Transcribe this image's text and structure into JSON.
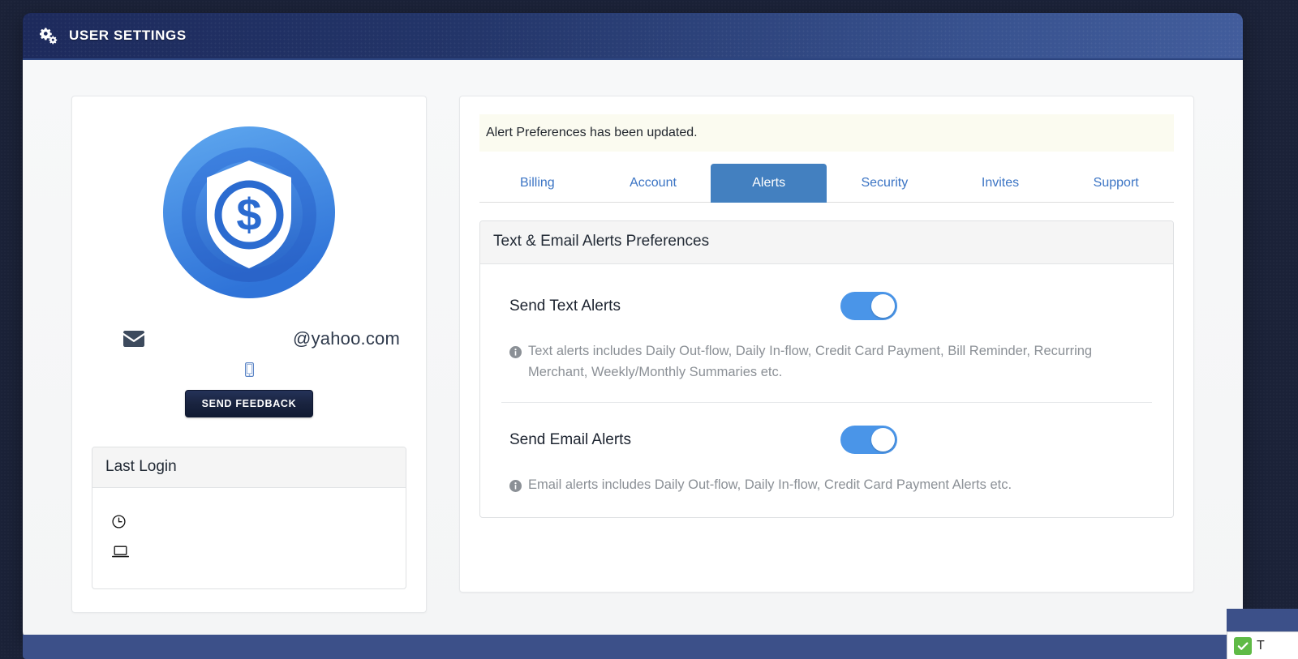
{
  "header": {
    "title": "USER SETTINGS",
    "icon": "gears-icon"
  },
  "profile": {
    "avatar_icon": "shield-dollar-logo",
    "email_icon": "envelope-icon",
    "email": "@yahoo.com",
    "phone_icon": "mobile-phone-icon",
    "phone": "",
    "feedback_button": "SEND FEEDBACK"
  },
  "last_login": {
    "title": "Last Login",
    "rows": [
      {
        "icon": "clock-icon",
        "value": ""
      },
      {
        "icon": "laptop-icon",
        "value": ""
      }
    ]
  },
  "notice": {
    "message": "Alert Preferences has been updated."
  },
  "tabs": [
    {
      "label": "Billing",
      "active": false
    },
    {
      "label": "Account",
      "active": false
    },
    {
      "label": "Alerts",
      "active": true
    },
    {
      "label": "Security",
      "active": false
    },
    {
      "label": "Invites",
      "active": false
    },
    {
      "label": "Support",
      "active": false
    }
  ],
  "preferences": {
    "panel_title": "Text & Email Alerts Preferences",
    "items": [
      {
        "label": "Send Text Alerts",
        "toggle_state": "on",
        "note": "Text alerts includes Daily Out-flow, Daily In-flow, Credit Card Payment, Bill Reminder, Recurring Merchant, Weekly/Monthly Summaries etc."
      },
      {
        "label": "Send Email Alerts",
        "toggle_state": "on",
        "note": "Email alerts includes Daily Out-flow, Daily In-flow, Credit Card Payment Alerts etc."
      }
    ]
  },
  "extension_widget": {
    "icon": "green-checkmark-icon",
    "label": "T"
  },
  "colors": {
    "header_gradient_start": "#1d2a5c",
    "header_gradient_end": "#425d9c",
    "page_background": "#1b2238",
    "accent_blue": "#4380c0",
    "toggle_on": "#4a95e8",
    "tab_link": "#3b74c4",
    "notice_background": "#fbfbf0",
    "feedback_button": "#1a2440",
    "bottom_bar": "#3c5089"
  }
}
